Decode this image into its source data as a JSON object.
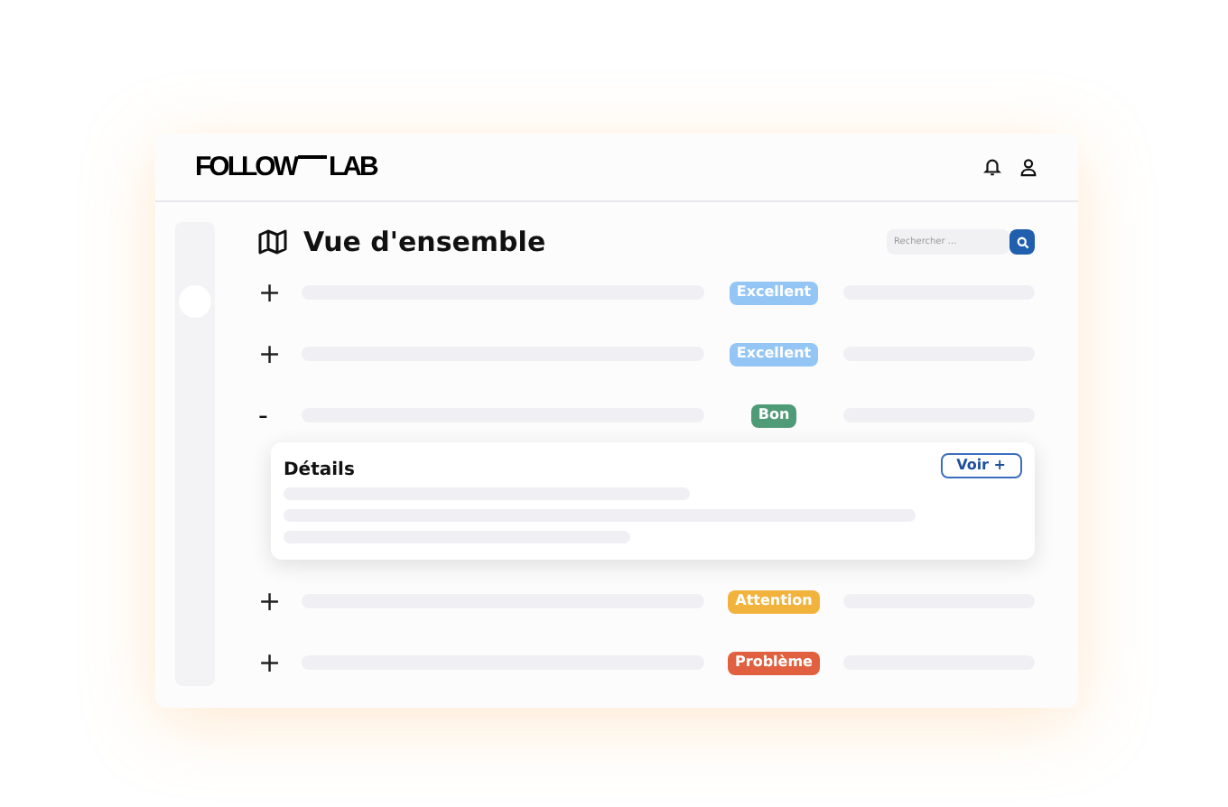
{
  "header": {
    "logo": [
      "FOLLOW",
      "LAB"
    ]
  },
  "page": {
    "title": "Vue d'ensemble",
    "search": {
      "placeholder": "Rechercher ..."
    }
  },
  "rows": [
    {
      "toggle": "+",
      "expanded": false,
      "badge": {
        "label": "Excellent",
        "color": "#93c5f5"
      }
    },
    {
      "toggle": "+",
      "expanded": false,
      "badge": {
        "label": "Excellent",
        "color": "#93c5f5"
      }
    },
    {
      "toggle": "-",
      "expanded": true,
      "badge": {
        "label": "Bon",
        "color": "#4f9a77"
      },
      "details": {
        "title": "Détails",
        "button": "Voir +"
      }
    },
    {
      "toggle": "+",
      "expanded": false,
      "badge": {
        "label": "Attention",
        "color": "#f2b33d"
      }
    },
    {
      "toggle": "+",
      "expanded": false,
      "badge": {
        "label": "Problème",
        "color": "#e0603f"
      }
    }
  ]
}
